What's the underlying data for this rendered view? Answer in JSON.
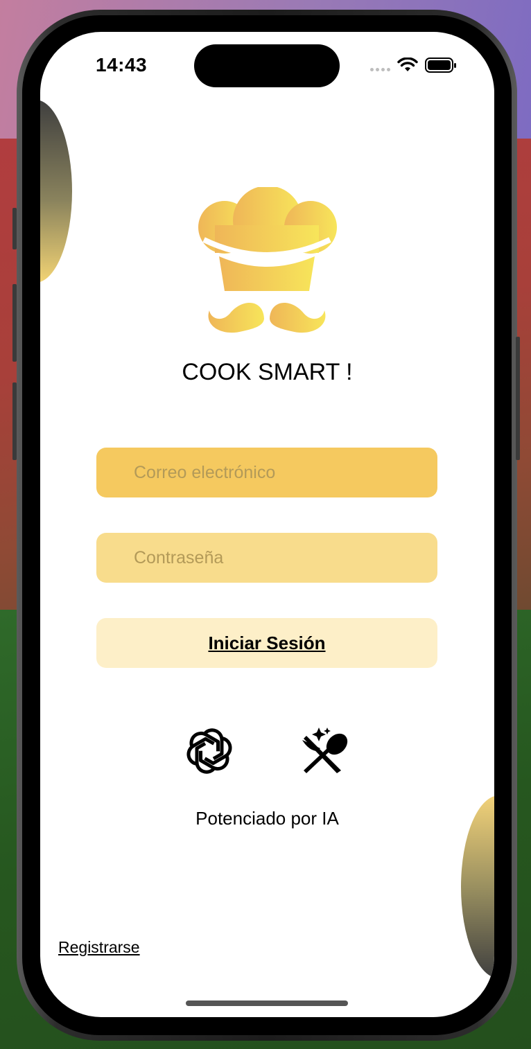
{
  "status_bar": {
    "time": "14:43"
  },
  "app": {
    "title": "COOK SMART !",
    "logo_icon": "chef-hat-mustache-logo",
    "brand_colors": {
      "gold": "#f5c95f",
      "gold_light": "#f8dc8c",
      "cream": "#fdefc8"
    }
  },
  "form": {
    "email_placeholder": "Correo electrónico",
    "password_placeholder": "Contraseña",
    "login_label": "Iniciar Sesión"
  },
  "ai_section": {
    "icons": [
      "openai-icon",
      "utensils-sparkle-icon"
    ],
    "powered_label": "Potenciado por IA"
  },
  "footer": {
    "register_label": "Registrarse"
  }
}
